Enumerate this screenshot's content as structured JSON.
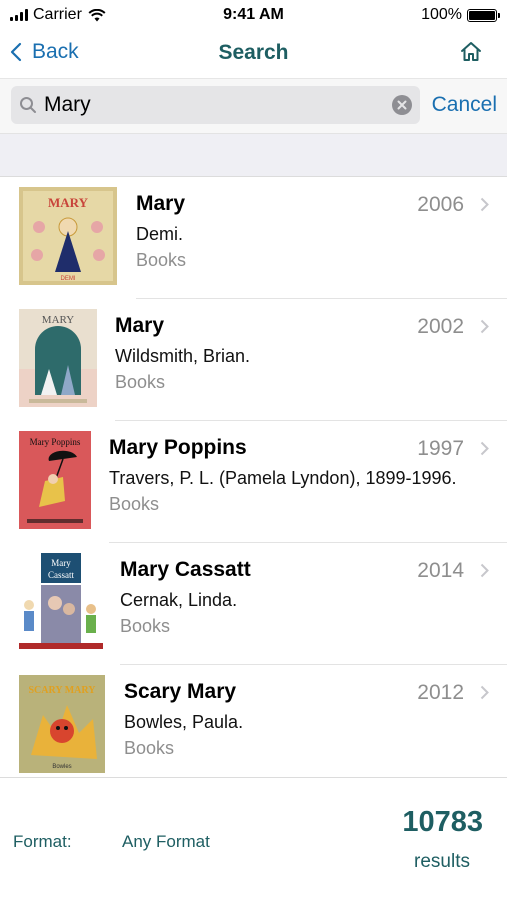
{
  "status": {
    "carrier": "Carrier",
    "time": "9:41 AM",
    "battery": "100%"
  },
  "nav": {
    "back_label": "Back",
    "title": "Search"
  },
  "search": {
    "query": "Mary",
    "cancel_label": "Cancel"
  },
  "results": [
    {
      "title": "Mary",
      "author": "Demi.",
      "format": "Books",
      "year": "2006",
      "cover_text": "MARY"
    },
    {
      "title": "Mary",
      "author": "Wildsmith, Brian.",
      "format": "Books",
      "year": "2002",
      "cover_text": "MARY"
    },
    {
      "title": "Mary Poppins",
      "author": "Travers, P. L. (Pamela Lyndon), 1899-1996.",
      "format": "Books",
      "year": "1997",
      "cover_text": "Mary Poppins"
    },
    {
      "title": "Mary Cassatt",
      "author": "Cernak, Linda.",
      "format": "Books",
      "year": "2014",
      "cover_text": "Mary Cassatt"
    },
    {
      "title": "Scary Mary",
      "author": "Bowles, Paula.",
      "format": "Books",
      "year": "2012",
      "cover_text": "SCARY MARY"
    }
  ],
  "footer": {
    "format_label": "Format:",
    "format_value": "Any Format",
    "count": "10783",
    "results_label": "results"
  },
  "colors": {
    "accent": "#1a6fb0",
    "brand": "#1e5e62",
    "muted": "#8e8e8e"
  }
}
